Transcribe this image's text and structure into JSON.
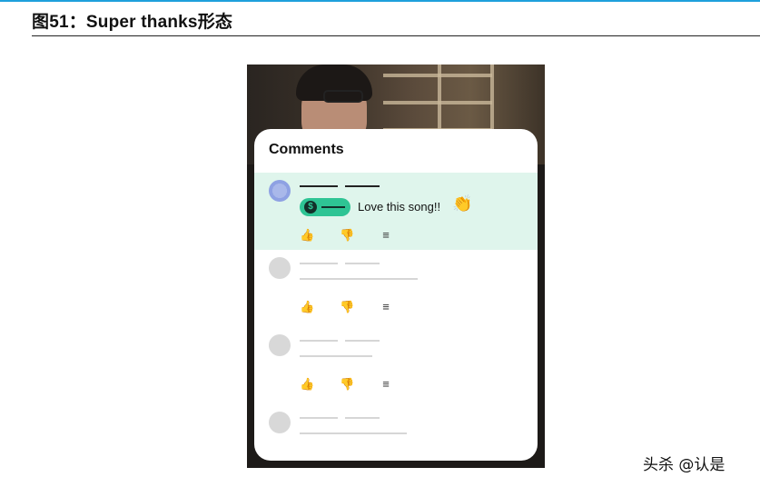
{
  "figure": {
    "title": "图51：Super thanks形态"
  },
  "comments_panel": {
    "header": "Comments",
    "highlight_comment": {
      "text": "Love this song!!",
      "coin_symbol": "$",
      "clap_icon": "clapping-hands-icon"
    },
    "action_icons": [
      "thumbs-up-icon",
      "thumbs-down-icon",
      "reply-icon"
    ]
  },
  "watermark": "头杀 @认是",
  "colors": {
    "accent_green": "#2ec494",
    "highlight_bg": "#dff5ec",
    "top_rule": "#1ea0dc"
  }
}
